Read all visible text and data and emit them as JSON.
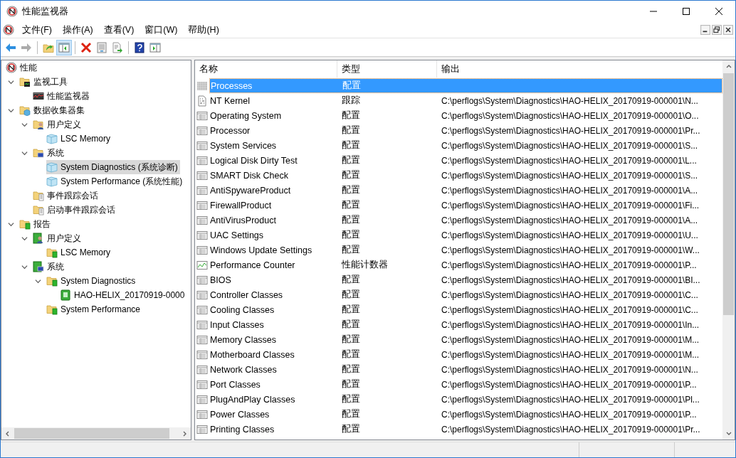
{
  "window": {
    "title": "性能监视器"
  },
  "menu": [
    {
      "label": "文件(F)"
    },
    {
      "label": "操作(A)"
    },
    {
      "label": "查看(V)"
    },
    {
      "label": "窗口(W)"
    },
    {
      "label": "帮助(H)"
    }
  ],
  "toolbar": [
    {
      "kind": "back",
      "disabled": false,
      "pressed": false
    },
    {
      "kind": "forward",
      "disabled": true,
      "pressed": false
    },
    {
      "kind": "sep"
    },
    {
      "kind": "up",
      "disabled": false,
      "pressed": false
    },
    {
      "kind": "tree",
      "disabled": false,
      "pressed": true
    },
    {
      "kind": "sep"
    },
    {
      "kind": "delete",
      "disabled": false,
      "pressed": false
    },
    {
      "kind": "properties",
      "disabled": false,
      "pressed": false
    },
    {
      "kind": "export",
      "disabled": false,
      "pressed": false
    },
    {
      "kind": "sep"
    },
    {
      "kind": "help",
      "disabled": false,
      "pressed": false
    },
    {
      "kind": "action",
      "disabled": false,
      "pressed": false
    }
  ],
  "tree": [
    {
      "label": "性能",
      "kind": "perf",
      "selected": false,
      "children": [
        {
          "label": "监视工具",
          "kind": "tools-folder",
          "selected": false,
          "expanded": true,
          "children": [
            {
              "label": "性能监视器",
              "kind": "monitor",
              "selected": false
            }
          ]
        },
        {
          "label": "数据收集器集",
          "kind": "collector-folder",
          "selected": false,
          "expanded": true,
          "children": [
            {
              "label": "用户定义",
              "kind": "user-folder",
              "selected": false,
              "expanded": true,
              "children": [
                {
                  "label": "LSC Memory",
                  "kind": "dataset",
                  "selected": false
                }
              ]
            },
            {
              "label": "系统",
              "kind": "system-folder",
              "selected": false,
              "expanded": true,
              "children": [
                {
                  "label": "System Diagnostics (系统诊断)",
                  "kind": "dataset",
                  "selected": true
                },
                {
                  "label": "System Performance (系统性能)",
                  "kind": "dataset",
                  "selected": false
                }
              ]
            },
            {
              "label": "事件跟踪会话",
              "kind": "trace-folder",
              "selected": false
            },
            {
              "label": "启动事件跟踪会话",
              "kind": "trace-folder",
              "selected": false
            }
          ]
        },
        {
          "label": "报告",
          "kind": "report-folder",
          "selected": false,
          "expanded": true,
          "children": [
            {
              "label": "用户定义",
              "kind": "report-user",
              "selected": false,
              "expanded": true,
              "children": [
                {
                  "label": "LSC Memory",
                  "kind": "report-folder",
                  "selected": false
                }
              ]
            },
            {
              "label": "系统",
              "kind": "report-system",
              "selected": false,
              "expanded": true,
              "children": [
                {
                  "label": "System Diagnostics",
                  "kind": "report-folder",
                  "selected": false,
                  "expanded": true,
                  "children": [
                    {
                      "label": "HAO-HELIX_20170919-0000",
                      "kind": "report",
                      "selected": false
                    }
                  ]
                },
                {
                  "label": "System Performance",
                  "kind": "report-folder",
                  "selected": false
                }
              ]
            }
          ]
        }
      ]
    }
  ],
  "table": {
    "columns": [
      "名称",
      "类型",
      "输出"
    ],
    "rows": [
      {
        "name": "Processes",
        "type": "配置",
        "output": "",
        "kind": "config",
        "selected": true
      },
      {
        "name": "NT Kernel",
        "type": "跟踪",
        "output": "C:\\perflogs\\System\\Diagnostics\\HAO-HELIX_20170919-000001\\N...",
        "kind": "trace",
        "selected": false
      },
      {
        "name": "Operating System",
        "type": "配置",
        "output": "C:\\perflogs\\System\\Diagnostics\\HAO-HELIX_20170919-000001\\O...",
        "kind": "config",
        "selected": false
      },
      {
        "name": "Processor",
        "type": "配置",
        "output": "C:\\perflogs\\System\\Diagnostics\\HAO-HELIX_20170919-000001\\Pr...",
        "kind": "config",
        "selected": false
      },
      {
        "name": "System Services",
        "type": "配置",
        "output": "C:\\perflogs\\System\\Diagnostics\\HAO-HELIX_20170919-000001\\S...",
        "kind": "config",
        "selected": false
      },
      {
        "name": "Logical Disk Dirty Test",
        "type": "配置",
        "output": "C:\\perflogs\\System\\Diagnostics\\HAO-HELIX_20170919-000001\\L...",
        "kind": "config",
        "selected": false
      },
      {
        "name": "SMART Disk Check",
        "type": "配置",
        "output": "C:\\perflogs\\System\\Diagnostics\\HAO-HELIX_20170919-000001\\S...",
        "kind": "config",
        "selected": false
      },
      {
        "name": "AntiSpywareProduct",
        "type": "配置",
        "output": "C:\\perflogs\\System\\Diagnostics\\HAO-HELIX_20170919-000001\\A...",
        "kind": "config",
        "selected": false
      },
      {
        "name": "FirewallProduct",
        "type": "配置",
        "output": "C:\\perflogs\\System\\Diagnostics\\HAO-HELIX_20170919-000001\\Fi...",
        "kind": "config",
        "selected": false
      },
      {
        "name": "AntiVirusProduct",
        "type": "配置",
        "output": "C:\\perflogs\\System\\Diagnostics\\HAO-HELIX_20170919-000001\\A...",
        "kind": "config",
        "selected": false
      },
      {
        "name": "UAC Settings",
        "type": "配置",
        "output": "C:\\perflogs\\System\\Diagnostics\\HAO-HELIX_20170919-000001\\U...",
        "kind": "config",
        "selected": false
      },
      {
        "name": "Windows Update Settings",
        "type": "配置",
        "output": "C:\\perflogs\\System\\Diagnostics\\HAO-HELIX_20170919-000001\\W...",
        "kind": "config",
        "selected": false
      },
      {
        "name": "Performance Counter",
        "type": "性能计数器",
        "output": "C:\\perflogs\\System\\Diagnostics\\HAO-HELIX_20170919-000001\\P...",
        "kind": "counter",
        "selected": false
      },
      {
        "name": "BIOS",
        "type": "配置",
        "output": "C:\\perflogs\\System\\Diagnostics\\HAO-HELIX_20170919-000001\\BI...",
        "kind": "config",
        "selected": false
      },
      {
        "name": "Controller Classes",
        "type": "配置",
        "output": "C:\\perflogs\\System\\Diagnostics\\HAO-HELIX_20170919-000001\\C...",
        "kind": "config",
        "selected": false
      },
      {
        "name": "Cooling Classes",
        "type": "配置",
        "output": "C:\\perflogs\\System\\Diagnostics\\HAO-HELIX_20170919-000001\\C...",
        "kind": "config",
        "selected": false
      },
      {
        "name": "Input Classes",
        "type": "配置",
        "output": "C:\\perflogs\\System\\Diagnostics\\HAO-HELIX_20170919-000001\\In...",
        "kind": "config",
        "selected": false
      },
      {
        "name": "Memory Classes",
        "type": "配置",
        "output": "C:\\perflogs\\System\\Diagnostics\\HAO-HELIX_20170919-000001\\M...",
        "kind": "config",
        "selected": false
      },
      {
        "name": "Motherboard Classes",
        "type": "配置",
        "output": "C:\\perflogs\\System\\Diagnostics\\HAO-HELIX_20170919-000001\\M...",
        "kind": "config",
        "selected": false
      },
      {
        "name": "Network Classes",
        "type": "配置",
        "output": "C:\\perflogs\\System\\Diagnostics\\HAO-HELIX_20170919-000001\\N...",
        "kind": "config",
        "selected": false
      },
      {
        "name": "Port Classes",
        "type": "配置",
        "output": "C:\\perflogs\\System\\Diagnostics\\HAO-HELIX_20170919-000001\\P...",
        "kind": "config",
        "selected": false
      },
      {
        "name": "PlugAndPlay Classes",
        "type": "配置",
        "output": "C:\\perflogs\\System\\Diagnostics\\HAO-HELIX_20170919-000001\\Pl...",
        "kind": "config",
        "selected": false
      },
      {
        "name": "Power Classes",
        "type": "配置",
        "output": "C:\\perflogs\\System\\Diagnostics\\HAO-HELIX_20170919-000001\\P...",
        "kind": "config",
        "selected": false
      },
      {
        "name": "Printing Classes",
        "type": "配置",
        "output": "C:\\perflogs\\System\\Diagnostics\\HAO-HELIX_20170919-000001\\Pr...",
        "kind": "config",
        "selected": false
      }
    ]
  }
}
